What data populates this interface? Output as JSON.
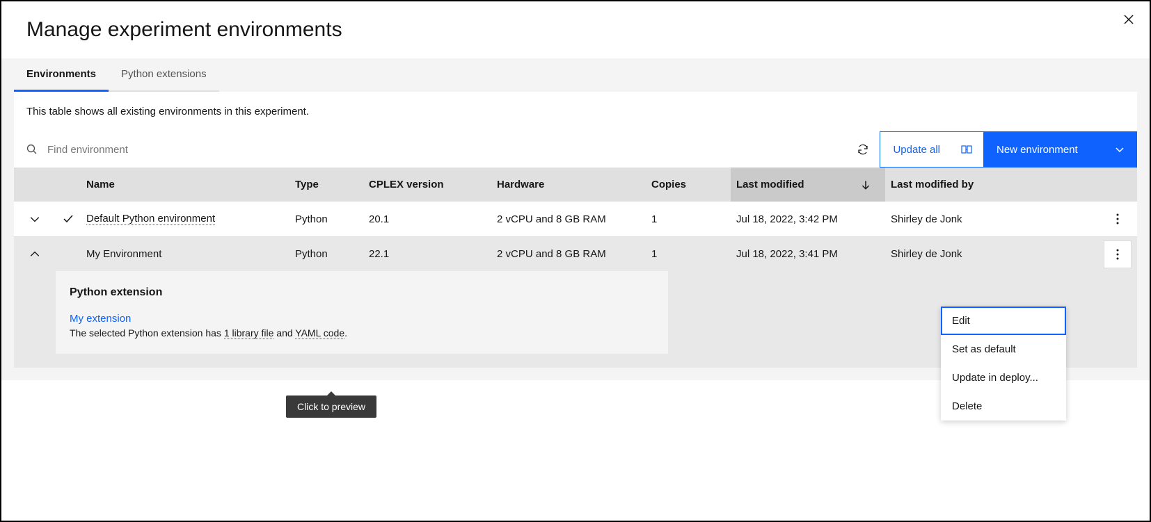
{
  "header": {
    "title": "Manage experiment environments"
  },
  "tabs": [
    {
      "label": "Environments",
      "active": true
    },
    {
      "label": "Python extensions",
      "active": false
    }
  ],
  "description": "This table shows all existing environments in this experiment.",
  "search": {
    "placeholder": "Find environment"
  },
  "toolbar": {
    "update_all_label": "Update all",
    "new_env_label": "New environment"
  },
  "table": {
    "headers": {
      "name": "Name",
      "type": "Type",
      "cplex": "CPLEX version",
      "hardware": "Hardware",
      "copies": "Copies",
      "modified": "Last modified",
      "modified_by": "Last modified by"
    },
    "rows": [
      {
        "name": "Default Python environment",
        "is_default": true,
        "type": "Python",
        "cplex": "20.1",
        "hardware": "2 vCPU and 8 GB RAM",
        "copies": "1",
        "modified": "Jul 18, 2022, 3:42 PM",
        "modified_by": "Shirley de Jonk",
        "expanded": false
      },
      {
        "name": "My Environment",
        "is_default": false,
        "type": "Python",
        "cplex": "22.1",
        "hardware": "2 vCPU and 8 GB RAM",
        "copies": "1",
        "modified": "Jul 18, 2022, 3:41 PM",
        "modified_by": "Shirley de Jonk",
        "expanded": true
      }
    ]
  },
  "extension_panel": {
    "title": "Python extension",
    "link_label": "My extension",
    "desc_prefix": "The selected Python extension has ",
    "lib_file": "1 library file",
    "desc_and": " and ",
    "yaml": "YAML code",
    "desc_suffix": "."
  },
  "tooltip": {
    "text": "Click to preview"
  },
  "context_menu": {
    "items": [
      {
        "label": "Edit",
        "highlighted": true
      },
      {
        "label": "Set as default",
        "highlighted": false
      },
      {
        "label": "Update in deploy...",
        "highlighted": false
      },
      {
        "label": "Delete",
        "highlighted": false
      }
    ]
  }
}
